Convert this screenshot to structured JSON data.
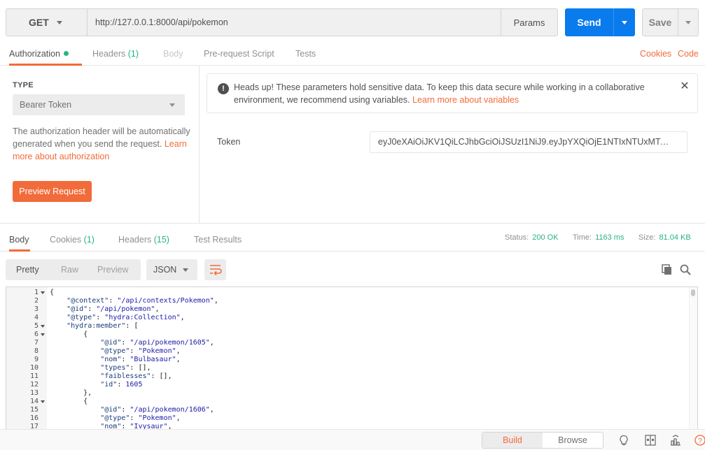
{
  "request": {
    "method": "GET",
    "url": "http://127.0.0.1:8000/api/pokemon",
    "params_label": "Params",
    "send_label": "Send",
    "save_label": "Save"
  },
  "request_tabs": {
    "authorization": "Authorization",
    "headers": "Headers",
    "headers_count": "(1)",
    "body": "Body",
    "prerequest": "Pre-request Script",
    "tests": "Tests",
    "cookies": "Cookies",
    "code": "Code"
  },
  "auth": {
    "type_label": "TYPE",
    "type_value": "Bearer Token",
    "description": "The authorization header will be automatically generated when you send the request.",
    "learn_link": "Learn more about authorization",
    "preview_button": "Preview Request",
    "warning_text": "Heads up! These parameters hold sensitive data. To keep this data secure while working in a collaborative environment, we recommend using variables.",
    "warning_link": "Learn more about variables",
    "token_label": "Token",
    "token_value": "eyJ0eXAiOiJKV1QiLCJhbGciOiJSUzI1NiJ9.eyJpYXQiOjE1NTIxNTUxMTAsImVtY..."
  },
  "response_tabs": {
    "body": "Body",
    "cookies": "Cookies",
    "cookies_count": "(1)",
    "headers": "Headers",
    "headers_count": "(15)",
    "test_results": "Test Results"
  },
  "response_meta": {
    "status_label": "Status:",
    "status_value": "200 OK",
    "time_label": "Time:",
    "time_value": "1163 ms",
    "size_label": "Size:",
    "size_value": "81.04 KB"
  },
  "response_toolbar": {
    "pretty": "Pretty",
    "raw": "Raw",
    "preview": "Preview",
    "format": "JSON"
  },
  "code_lines": [
    {
      "n": "1",
      "fold": true,
      "text": "{"
    },
    {
      "n": "2",
      "fold": false,
      "text": "    \"@context\": \"/api/contexts/Pokemon\","
    },
    {
      "n": "3",
      "fold": false,
      "text": "    \"@id\": \"/api/pokemon\","
    },
    {
      "n": "4",
      "fold": false,
      "text": "    \"@type\": \"hydra:Collection\","
    },
    {
      "n": "5",
      "fold": true,
      "text": "    \"hydra:member\": ["
    },
    {
      "n": "6",
      "fold": true,
      "text": "        {"
    },
    {
      "n": "7",
      "fold": false,
      "text": "            \"@id\": \"/api/pokemon/1605\","
    },
    {
      "n": "8",
      "fold": false,
      "text": "            \"@type\": \"Pokemon\","
    },
    {
      "n": "9",
      "fold": false,
      "text": "            \"nom\": \"Bulbasaur\","
    },
    {
      "n": "10",
      "fold": false,
      "text": "            \"types\": [],"
    },
    {
      "n": "11",
      "fold": false,
      "text": "            \"faiblesses\": [],"
    },
    {
      "n": "12",
      "fold": false,
      "text": "            \"id\": 1605"
    },
    {
      "n": "13",
      "fold": false,
      "text": "        },"
    },
    {
      "n": "14",
      "fold": true,
      "text": "        {"
    },
    {
      "n": "15",
      "fold": false,
      "text": "            \"@id\": \"/api/pokemon/1606\","
    },
    {
      "n": "16",
      "fold": false,
      "text": "            \"@type\": \"Pokemon\","
    },
    {
      "n": "17",
      "fold": false,
      "text": "            \"nom\": \"Ivysaur\","
    }
  ],
  "statusbar": {
    "build": "Build",
    "browse": "Browse"
  },
  "colors": {
    "accent": "#f26b3a",
    "send": "#097bed",
    "success": "#26b47f"
  }
}
